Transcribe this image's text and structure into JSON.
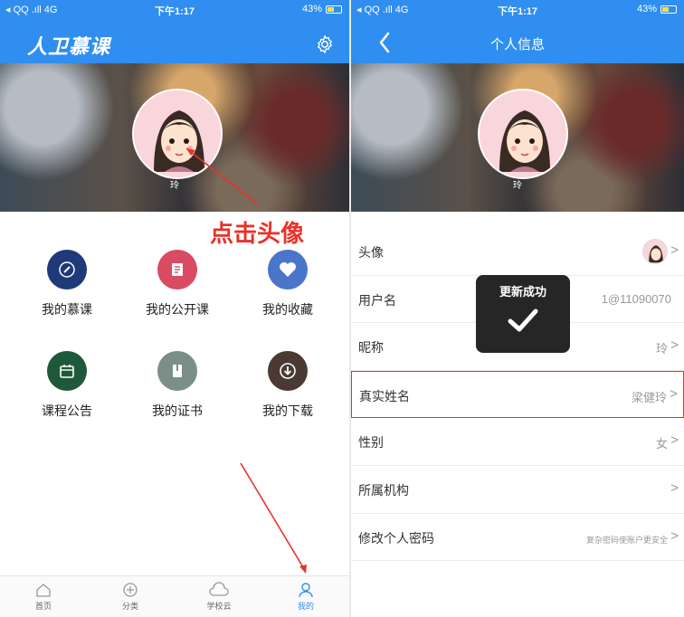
{
  "status": {
    "carrier": "◂ QQ .ıll 4G",
    "time": "下午1:17",
    "battery": "43%"
  },
  "left": {
    "logo": "人卫慕课",
    "profile_name": "玲",
    "annotation": "点击头像",
    "menu": [
      {
        "label": "我的慕课",
        "icon": "pencil-icon",
        "color": "#1f3a78"
      },
      {
        "label": "我的公开课",
        "icon": "document-icon",
        "color": "#d94a63"
      },
      {
        "label": "我的收藏",
        "icon": "heart-icon",
        "color": "#4a76c9"
      },
      {
        "label": "课程公告",
        "icon": "calendar-icon",
        "color": "#1e5a3a"
      },
      {
        "label": "我的证书",
        "icon": "book-icon",
        "color": "#7b8f88"
      },
      {
        "label": "我的下载",
        "icon": "download-icon",
        "color": "#4a3a33"
      }
    ],
    "tabs": [
      {
        "label": "首页",
        "icon": "home-icon"
      },
      {
        "label": "分类",
        "icon": "plus-circle-icon"
      },
      {
        "label": "学校云",
        "icon": "cloud-icon"
      },
      {
        "label": "我的",
        "icon": "person-icon",
        "active": true
      }
    ]
  },
  "right": {
    "title": "个人信息",
    "profile_name": "玲",
    "rows": [
      {
        "label": "头像",
        "value": ""
      },
      {
        "label": "用户名",
        "value": "1@11090070"
      },
      {
        "label": "昵称",
        "value": "玲"
      },
      {
        "label": "真实姓名",
        "value": "梁健玲",
        "highlight": true
      },
      {
        "label": "性别",
        "value": "女"
      },
      {
        "label": "所属机构",
        "value": ""
      },
      {
        "label": "修改个人密码",
        "value": "复杂密码使账户更安全"
      }
    ],
    "toast": "更新成功"
  },
  "colors": {
    "primary": "#2f8ef0",
    "annotation": "#e8322a"
  }
}
